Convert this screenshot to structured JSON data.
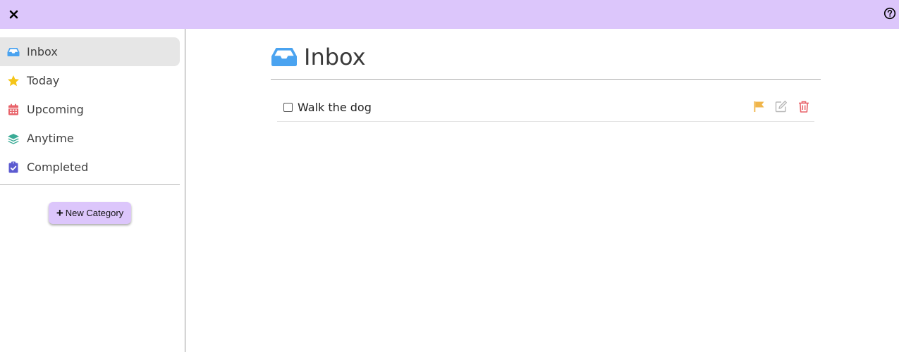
{
  "app": {
    "close_icon": "close-icon",
    "help_icon": "question-circle-icon",
    "accent_color": "#dcc6fb"
  },
  "sidebar": {
    "items": [
      {
        "label": "Inbox",
        "icon": "inbox-tray-icon",
        "color": "#4aa3f0",
        "active": true
      },
      {
        "label": "Today",
        "icon": "star-icon",
        "color": "#f5c518",
        "active": false
      },
      {
        "label": "Upcoming",
        "icon": "calendar-icon",
        "color": "#e8636a",
        "active": false
      },
      {
        "label": "Anytime",
        "icon": "layers-icon",
        "color": "#3aab96",
        "active": false
      },
      {
        "label": "Completed",
        "icon": "clipboard-check-icon",
        "color": "#5c5bd0",
        "active": false
      }
    ],
    "new_category_label": "New Category"
  },
  "main": {
    "title": "Inbox",
    "title_icon": "inbox-tray-icon",
    "tasks": [
      {
        "label": "Walk the dog",
        "completed": false,
        "actions": [
          {
            "name": "flag-icon",
            "color": "#f0b54a"
          },
          {
            "name": "edit-icon",
            "color": "#b8b8b8"
          },
          {
            "name": "trash-icon",
            "color": "#e8636a"
          }
        ]
      }
    ]
  }
}
